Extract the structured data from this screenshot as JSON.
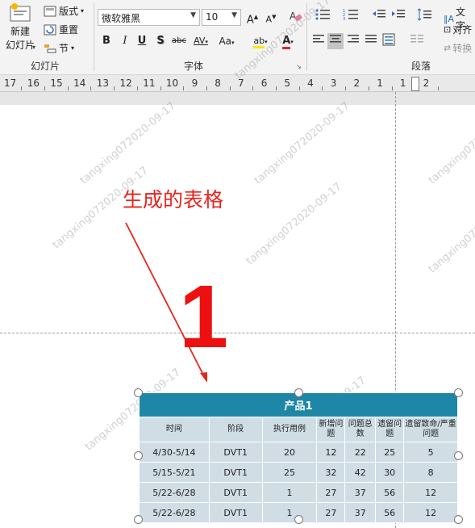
{
  "ribbon": {
    "slides_group": {
      "label": "幻灯片",
      "new_slide": "新建\n幻灯片",
      "new_slide_line1": "新建",
      "new_slide_line2": "幻灯片",
      "layout": "版式",
      "reset": "重置",
      "section": "节"
    },
    "font_group": {
      "label": "字体",
      "font_name": "微软雅黑",
      "font_size": "10",
      "bold": "B",
      "italic": "I",
      "underline": "U",
      "shadow": "S",
      "strike": "abc",
      "spacing": "AV",
      "case": "Aa",
      "grow": "A",
      "shrink": "A",
      "highlight": "ab",
      "font_color": "A"
    },
    "paragraph_group": {
      "label": "段落",
      "text_direction": "文字",
      "align_text": "对齐",
      "convert": "转换"
    }
  },
  "ruler": {
    "labels": [
      "17",
      "16",
      "15",
      "14",
      "13",
      "12",
      "11",
      "10",
      "9",
      "8",
      "7",
      "6",
      "5",
      "4",
      "3",
      "2",
      "1",
      "1",
      "2"
    ]
  },
  "watermarks": [
    "tangxing072020-09-17"
  ],
  "slide": {
    "annotation": "生成的表格",
    "big_number": "1"
  },
  "table": {
    "title": "产品1",
    "headers": [
      "时间",
      "阶段",
      "执行用例",
      "新增问题",
      "问题总数",
      "遗留问题",
      "遗留致命/严重问题"
    ],
    "rows": [
      [
        "4/30-5/14",
        "DVT1",
        "20",
        "12",
        "22",
        "25",
        "5"
      ],
      [
        "5/15-5/21",
        "DVT1",
        "25",
        "32",
        "42",
        "30",
        "8"
      ],
      [
        "5/22-6/28",
        "DVT1",
        "1",
        "27",
        "37",
        "56",
        "12"
      ],
      [
        "5/22-6/28",
        "DVT1",
        "1",
        "27",
        "37",
        "56",
        "12"
      ]
    ]
  },
  "colors": {
    "table_title_bg": "#1e86a6",
    "table_cell_bg": "#d0dde5",
    "annotation": "#e8241c",
    "big_number": "#ee1010"
  }
}
